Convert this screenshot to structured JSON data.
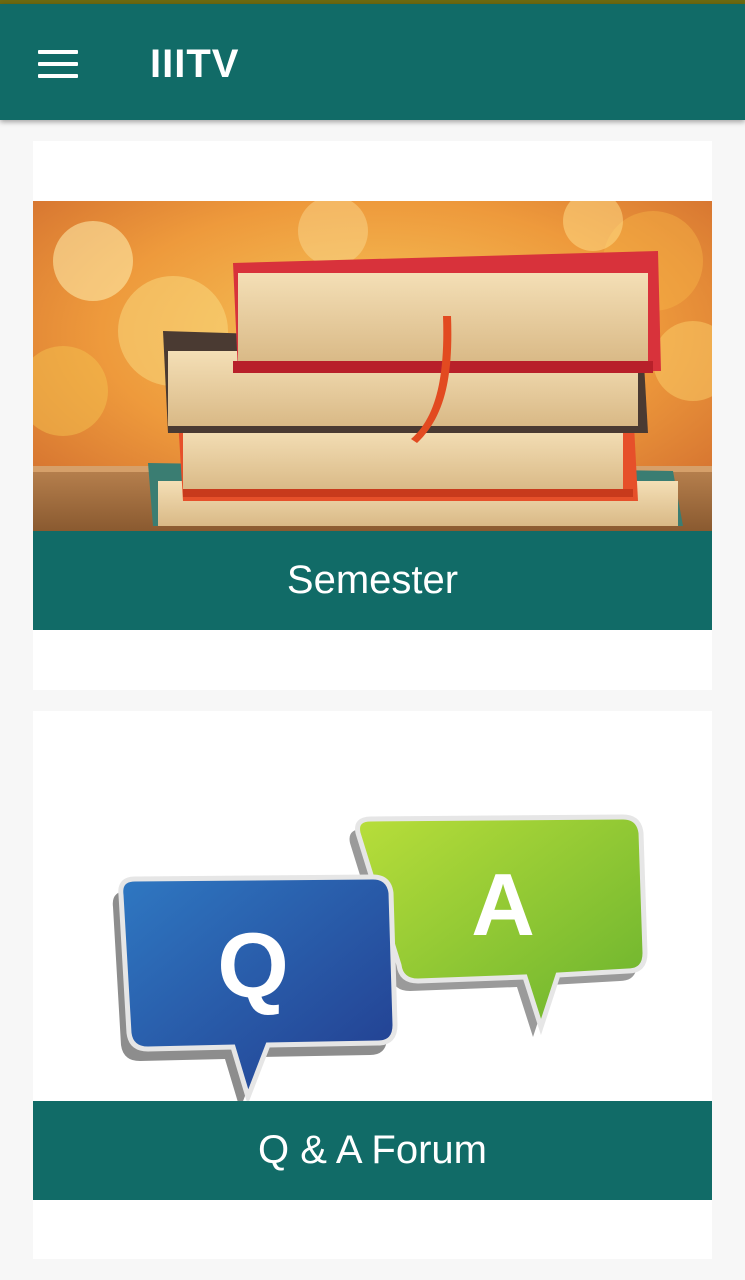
{
  "app": {
    "title": "IIITV"
  },
  "icons": {
    "menu": "hamburger-menu-icon"
  },
  "colors": {
    "primary": "#116b67",
    "background": "#f7f7f7",
    "card": "#ffffff"
  },
  "cards": [
    {
      "label": "Semester",
      "image": "stack-of-books"
    },
    {
      "label": "Q & A Forum",
      "image": "q-and-a-speech-bubbles"
    }
  ]
}
